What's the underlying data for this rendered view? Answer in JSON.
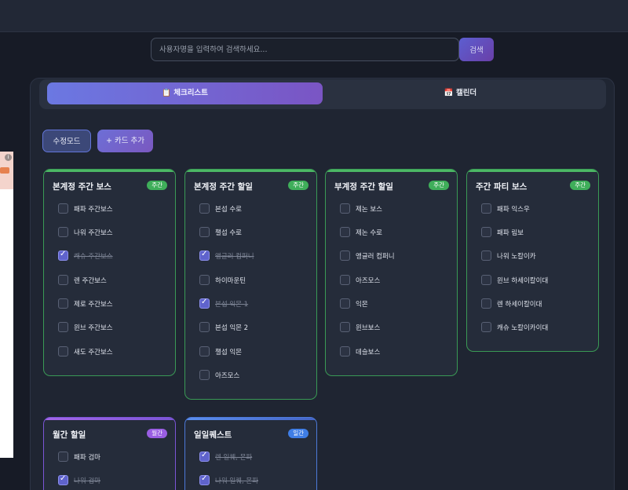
{
  "search": {
    "placeholder": "사용자명을 입력하여 검색하세요...",
    "value": "",
    "button_label": "검색"
  },
  "tabs": [
    {
      "label": "📋 체크리스트",
      "active": true
    },
    {
      "label": "📅 캘린더",
      "active": false
    }
  ],
  "toolbar": {
    "edit_label": "수정모드",
    "add_label": "+ 카드 추가"
  },
  "side_ad": {
    "info_icon": "i"
  },
  "cards": [
    {
      "title": "본계정 주간 보스",
      "badge": "주간",
      "kind": "week",
      "items": [
        {
          "label": "패파 주간보스",
          "checked": false
        },
        {
          "label": "나워 주간보스",
          "checked": false
        },
        {
          "label": "캐슈 주간보스",
          "checked": true
        },
        {
          "label": "렌 주간보스",
          "checked": false
        },
        {
          "label": "제로 주간보스",
          "checked": false
        },
        {
          "label": "윈브 주간보스",
          "checked": false
        },
        {
          "label": "새도 주간보스",
          "checked": false
        }
      ]
    },
    {
      "title": "본계정 주간 할일",
      "badge": "주간",
      "kind": "week",
      "items": [
        {
          "label": "본섭 수로",
          "checked": false
        },
        {
          "label": "챌섭 수로",
          "checked": false
        },
        {
          "label": "앵글러 컴퍼니",
          "checked": true
        },
        {
          "label": "하이마운틴",
          "checked": false
        },
        {
          "label": "본섭 익몬 1",
          "checked": true
        },
        {
          "label": "본섭 익몬 2",
          "checked": false
        },
        {
          "label": "챌섭 익몬",
          "checked": false
        },
        {
          "label": "아즈모스",
          "checked": false
        }
      ]
    },
    {
      "title": "부계정 주간 할일",
      "badge": "주간",
      "kind": "week",
      "items": [
        {
          "label": "제논 보스",
          "checked": false
        },
        {
          "label": "제논 수로",
          "checked": false
        },
        {
          "label": "앵글러 컴퍼니",
          "checked": false
        },
        {
          "label": "아즈모스",
          "checked": false
        },
        {
          "label": "익몬",
          "checked": false
        },
        {
          "label": "윈브보스",
          "checked": false
        },
        {
          "label": "데슬보스",
          "checked": false
        }
      ]
    },
    {
      "title": "주간 파티 보스",
      "badge": "주간",
      "kind": "week",
      "items": [
        {
          "label": "패파 익스우",
          "checked": false
        },
        {
          "label": "패파 림보",
          "checked": false
        },
        {
          "label": "나워 노칼이카",
          "checked": false
        },
        {
          "label": "윈브 하세이칼이대",
          "checked": false
        },
        {
          "label": "렌 하세이칼이대",
          "checked": false
        },
        {
          "label": "캐슈 노칼이카이대",
          "checked": false
        }
      ]
    },
    {
      "title": "월간 할일",
      "badge": "월간",
      "kind": "month",
      "items": [
        {
          "label": "패파 검마",
          "checked": false
        },
        {
          "label": "나워 검마",
          "checked": true
        }
      ]
    },
    {
      "title": "일일퀘스트",
      "badge": "일간",
      "kind": "day",
      "items": [
        {
          "label": "렌 일퀘, 몬파",
          "checked": true
        },
        {
          "label": "나워 일퀘, 몬파",
          "checked": true
        }
      ]
    }
  ]
}
